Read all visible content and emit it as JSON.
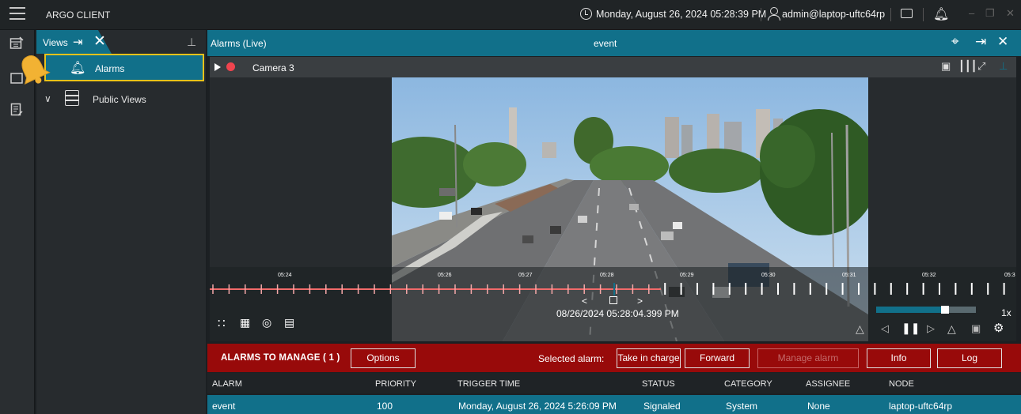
{
  "app": {
    "title": "ARGO CLIENT",
    "datetime": "Monday, August 26, 2024 05:28:39 PM",
    "user": "admin@laptop-uftc64rp"
  },
  "views": {
    "label": "Views",
    "items": [
      {
        "label": "Alarms",
        "icon": "bell-icon",
        "selected": true
      },
      {
        "label": "Public Views",
        "icon": "list-view-icon",
        "expanded": false
      }
    ]
  },
  "main": {
    "title": "Alarms (Live)",
    "center_title": "event",
    "camera_name": "Camera 3",
    "timeline": {
      "tick_labels": [
        "05:24",
        "05:26",
        "05:27",
        "05:28",
        "05:29",
        "05:30",
        "05:31",
        "05:32",
        "05:3"
      ],
      "timestamp": "08/26/2024 05:28:04.399 PM",
      "speed": "1x",
      "speed_level": 0.65
    }
  },
  "manage": {
    "title": "ALARMS TO MANAGE ( 1 )",
    "options_label": "Options",
    "selected_label": "Selected alarm:",
    "take_in_charge": "Take in charge",
    "forward": "Forward",
    "manage_alarm": "Manage alarm",
    "info": "Info",
    "log": "Log"
  },
  "table": {
    "headers": [
      "ALARM",
      "PRIORITY",
      "TRIGGER TIME",
      "STATUS",
      "CATEGORY",
      "ASSIGNEE",
      "NODE"
    ],
    "rows": [
      [
        "event",
        "100",
        "Monday, August 26, 2024 5:26:09 PM",
        "Signaled",
        "System",
        "None",
        "laptop-uftc64rp"
      ]
    ]
  },
  "colors": {
    "accent": "#11708a",
    "alarm_bar": "#980a0a",
    "highlight_border": "#e8c21a",
    "recording": "#f0444e"
  }
}
